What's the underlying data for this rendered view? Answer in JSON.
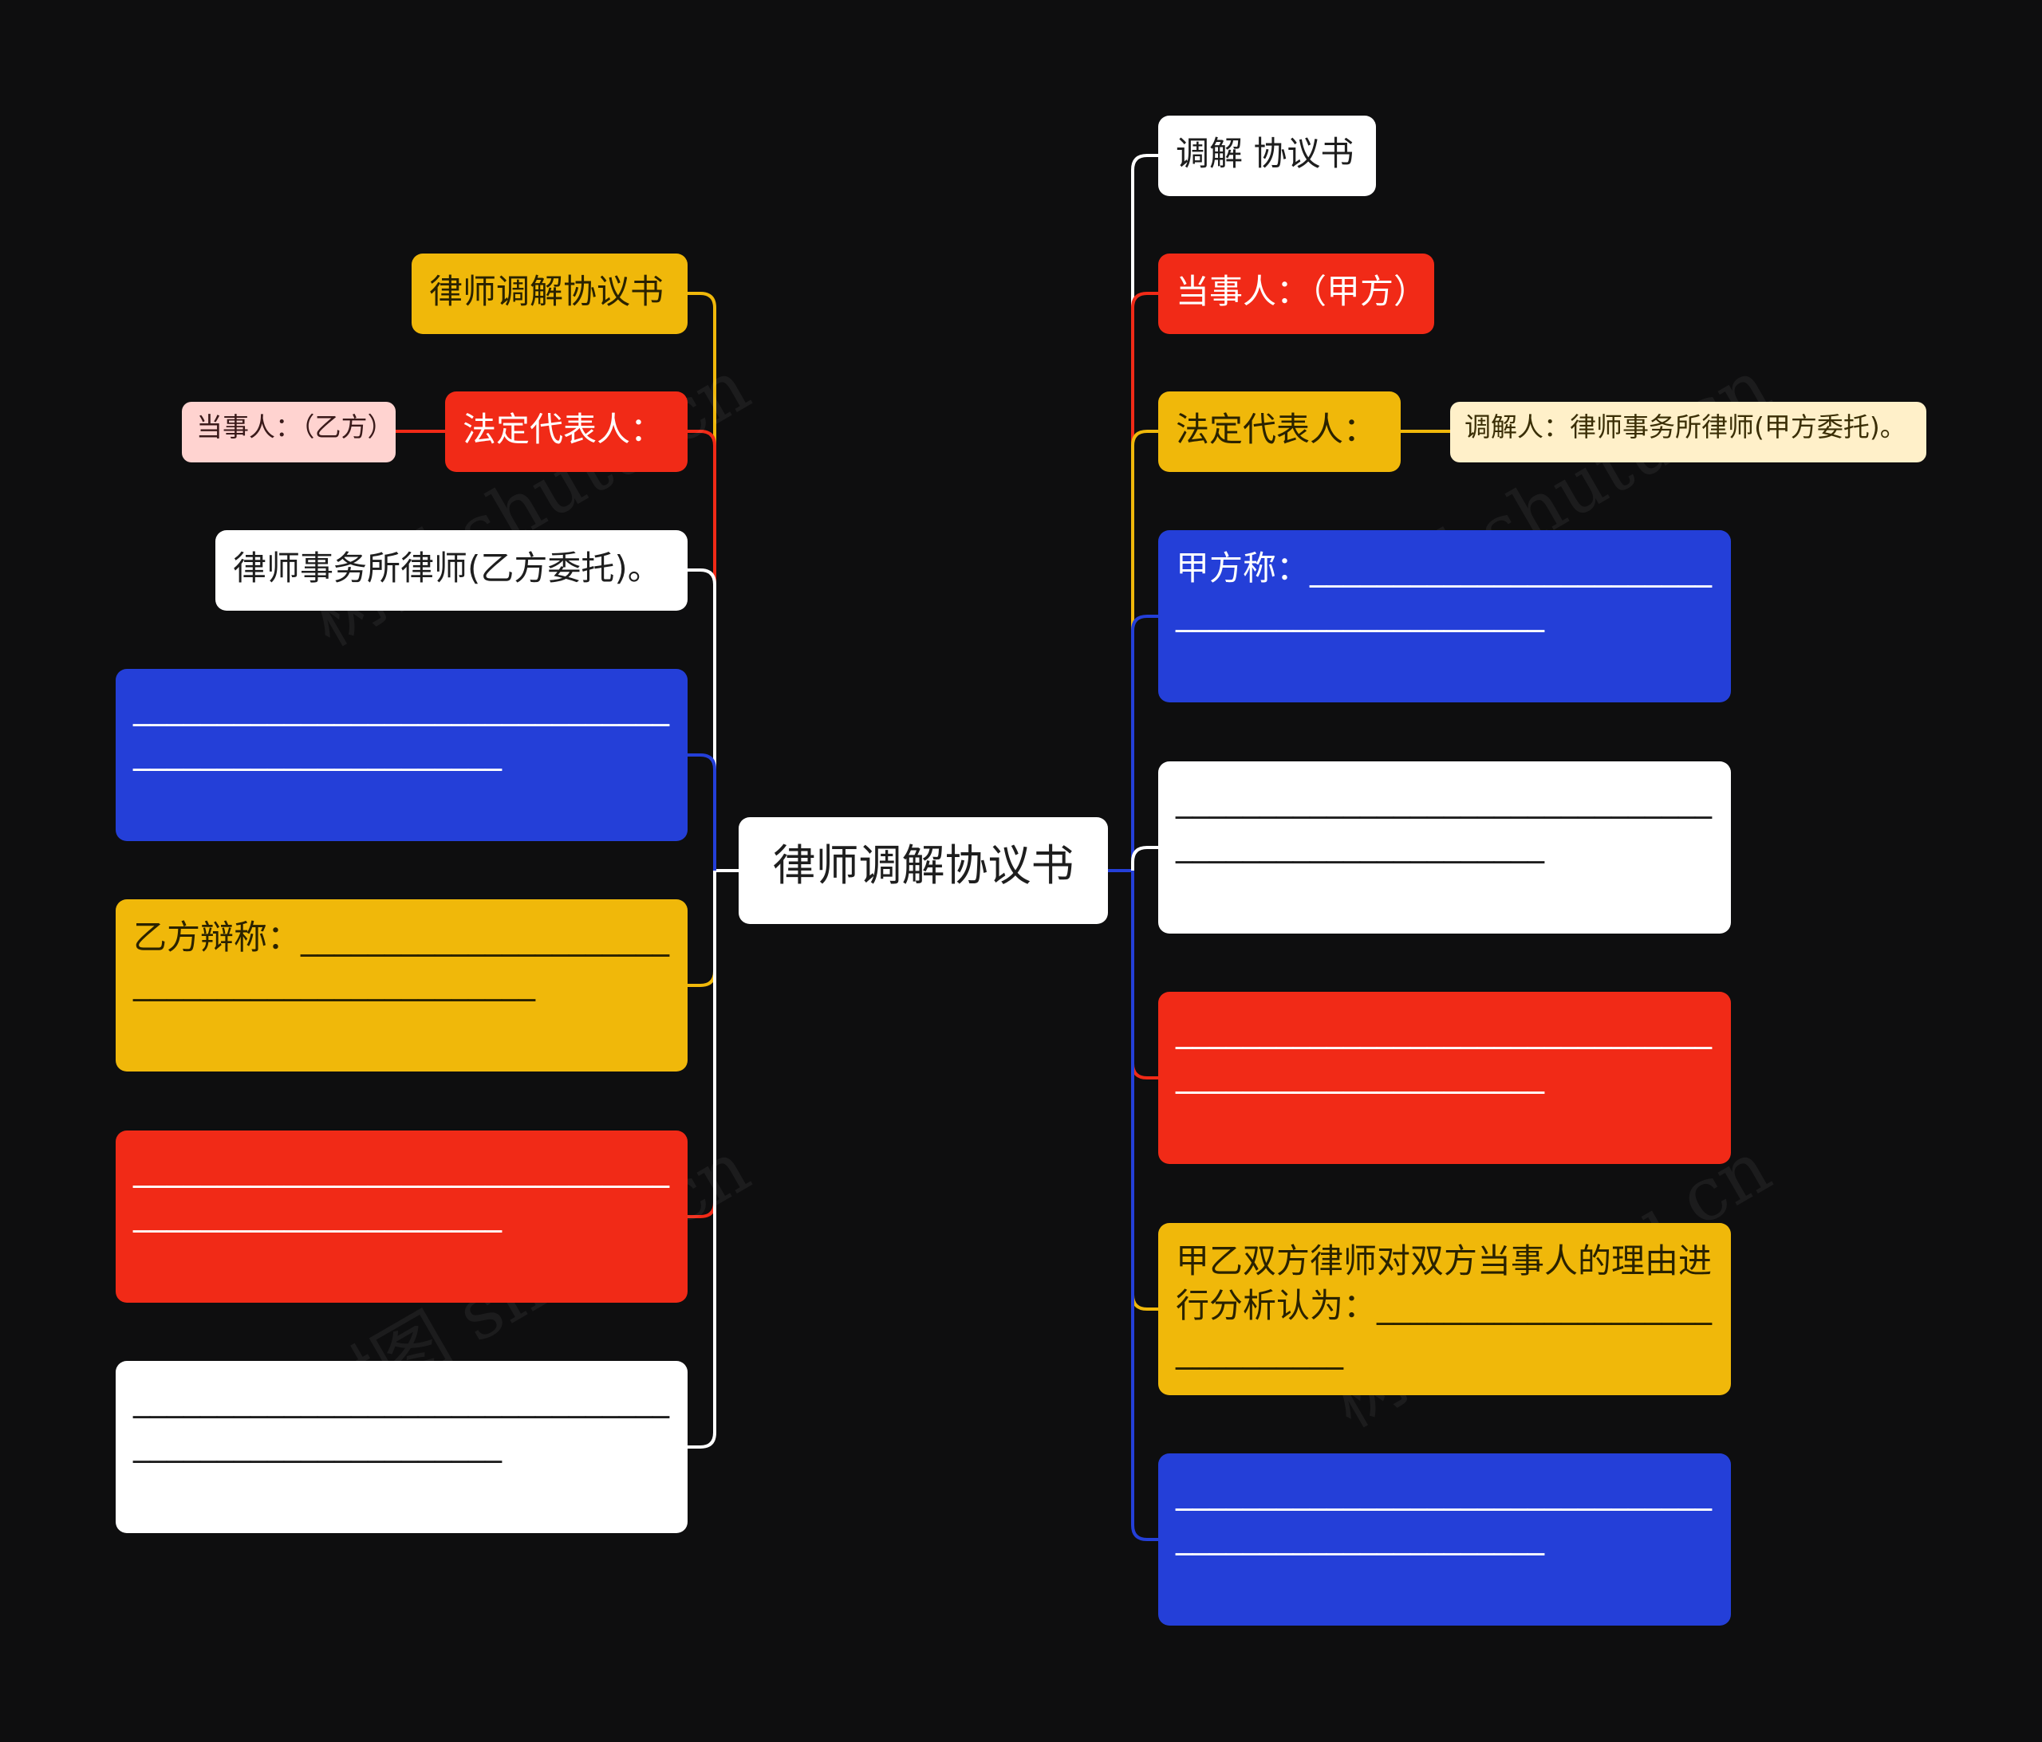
{
  "root": {
    "label": "律师调解协议书"
  },
  "left_nodes": [
    {
      "id": "l1",
      "label": "律师调解协议书",
      "color": "yellow"
    },
    {
      "id": "l2",
      "label": "法定代表人：",
      "color": "red"
    },
    {
      "id": "l2a",
      "label": "当事人：（乙方）",
      "color": "pink"
    },
    {
      "id": "l3",
      "label": "律师事务所律师(乙方委托)。",
      "color": "white"
    },
    {
      "id": "l4",
      "label": "______________________________________________________",
      "color": "blue"
    },
    {
      "id": "l5",
      "label": "乙方辩称：______________________________________________",
      "color": "yellow"
    },
    {
      "id": "l6",
      "label": "______________________________________________________",
      "color": "red"
    },
    {
      "id": "l7",
      "label": "______________________________________________________",
      "color": "white"
    }
  ],
  "right_nodes": [
    {
      "id": "r1",
      "label": "调解 协议书",
      "color": "white"
    },
    {
      "id": "r2",
      "label": "当事人：（甲方）",
      "color": "red"
    },
    {
      "id": "r3",
      "label": "法定代表人：",
      "color": "yellow"
    },
    {
      "id": "r3a",
      "label": "调解人：律师事务所律师(甲方委托)。",
      "color": "cream"
    },
    {
      "id": "r4",
      "label": "甲方称：______________________________________________",
      "color": "blue"
    },
    {
      "id": "r5",
      "label": "______________________________________________________",
      "color": "white"
    },
    {
      "id": "r6",
      "label": "______________________________________________________",
      "color": "red"
    },
    {
      "id": "r7",
      "label": "甲乙双方律师对双方当事人的理由进行分析认为：______________________________",
      "color": "yellow"
    },
    {
      "id": "r8",
      "label": "______________________________________________________",
      "color": "blue"
    }
  ],
  "watermark": "树图 shutu.cn",
  "colors": {
    "background": "#0e0e0f",
    "white": "#ffffff",
    "red": "#f12a17",
    "yellow": "#f0b80a",
    "blue": "#243fd8",
    "pink": "#ffd3d0",
    "cream": "#fff0c9"
  }
}
